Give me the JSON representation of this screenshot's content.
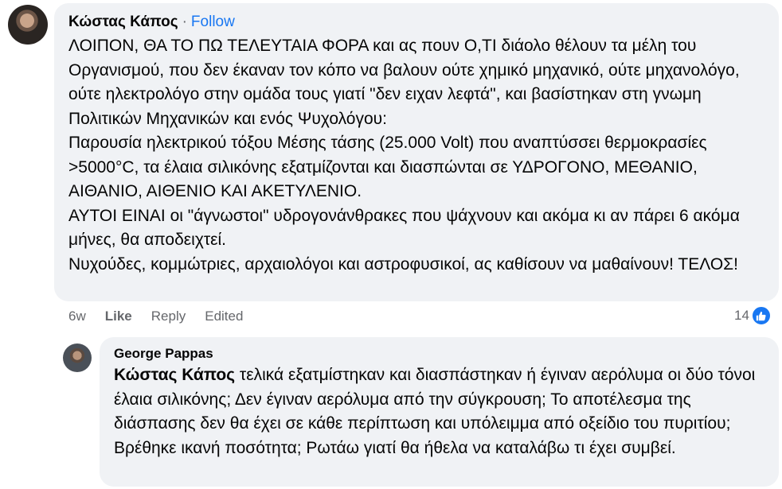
{
  "comment": {
    "author": "Κώστας Κάπος",
    "separator": "·",
    "follow_label": "Follow",
    "paragraphs": [
      "ΛΟΙΠΟΝ, ΘΑ ΤΟ ΠΩ ΤΕΛΕΥΤΑΙΑ ΦΟΡΑ και ας πουν Ο,ΤΙ διάολο θέλουν τα μέλη του Οργανισμού, που δεν έκαναν τον κόπο να βαλουν ούτε χημικό μηχανικό, ούτε μηχανολόγο, ούτε ηλεκτρολόγο στην ομάδα τους γιατί \"δεν ειχαν λεφτά\", και βασίστηκαν στη γνωμη Πολιτικών Μηχανικών και ενός Ψυχολόγου:",
      "Παρουσία ηλεκτρικού τόξου Μέσης τάσης (25.000 Volt) που αναπτύσσει θερμοκρασίες >5000°C, τα έλαια σιλικόνης εξατμίζονται και διασπώνται σε ΥΔΡΟΓΟΝΟ, ΜΕΘΑΝΙΟ, ΑΙΘΑΝΙΟ, ΑΙΘΕΝΙΟ ΚΑΙ ΑΚΕΤΥΛΕΝΙΟ.",
      "ΑΥΤΟΙ ΕΙΝΑΙ οι \"άγνωστοι\" υδρογονάνθρακες που ψάχνουν και ακόμα κι αν πάρει 6 ακόμα μήνες, θα αποδειχτεί.",
      "Νυχούδες, κομμώτριες, αρχαιολόγοι και αστροφυσικοί, ας καθίσουν να μαθαίνουν! ΤΕΛΟΣ!"
    ],
    "time": "6w",
    "like_label": "Like",
    "reply_label": "Reply",
    "edited_label": "Edited",
    "reaction_count": "14"
  },
  "reply": {
    "author": "George Pappas",
    "mention": "Κώστας Κάπος",
    "text": " τελικά εξατμίστηκαν και διασπάστηκαν ή έγιναν αερόλυμα οι δύο τόνοι έλαια σιλικόνης; Δεν έγιναν αερόλυμα από την σύγκρουση; Το αποτέλεσμα της διάσπασης δεν θα έχει σε κάθε περίπτωση και υπόλειμμα από οξείδιο του πυριτίου; Βρέθηκε ικανή ποσότητα; Ρωτάω γιατί θα ήθελα να καταλάβω τι έχει συμβεί."
  },
  "colors": {
    "bubble": "#f0f2f5",
    "link": "#1877f2",
    "secondary_text": "#65676b"
  }
}
